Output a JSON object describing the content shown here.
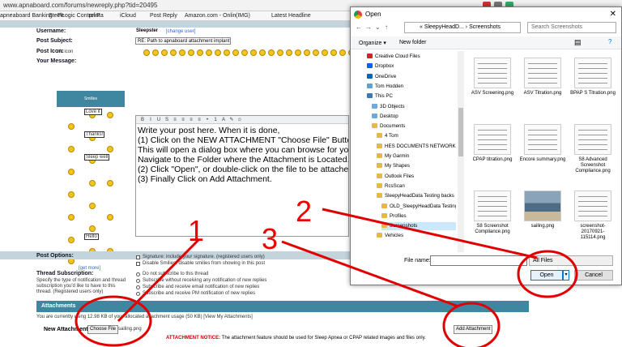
{
  "browser": {
    "url": "www.apnaboard.com/forums/newreply.php?tid=20495",
    "bookmarks": [
      "apneaboard Banking - Pe",
      "SteelLogic Control Pa",
      "print",
      "iCloud",
      "Post Reply",
      "Amazon.com - Onlin",
      "(IMG)",
      "Latest Headline"
    ]
  },
  "form": {
    "username_label": "Username:",
    "username_value": "Sleepster",
    "username_change": "[change user]",
    "subject_label": "Post Subject:",
    "subject_value": "RE: Path to apnaboard attachment implant begins",
    "icon_label": "Post Icon:",
    "icon_none": "no icon",
    "message_label": "Your Message:",
    "smiley_header": "Smilies",
    "smiley_captions": [
      "Love it",
      "Thanks!",
      "Sleep well",
      "Hello"
    ],
    "get_more": "[get more]",
    "editor_lines": [
      "Write your post here. When it is done,",
      "(1) Click on the NEW ATTACHMENT \"Choose File\" Button.",
      "This will open a dialog box where you can browse for your attachment.",
      "Navigate to the Folder where the Attachment is Located.",
      "(2) Click \"Open\", or double-click on the file to be attached.",
      "(3) Finally Click on Add Attachment."
    ],
    "options_label": "Post Options:",
    "option_signature": "Signature: include your signature. (registered users only)",
    "option_disable_smilies": "Disable Smilies: disable smilies from showing in this post",
    "thread_sub_label": "Thread Subscription:",
    "thread_sub_desc": "Specify the type of notification and thread subscription you'd like to have to this thread. (Registered users only)",
    "thread_options": [
      "Do not subscribe to this thread",
      "Subscribe without receiving any notification of new replies",
      "Subscribe and receive email notification of new replies",
      "Subscribe and receive PM notification of new replies"
    ]
  },
  "attachments": {
    "header": "Attachments",
    "usage": "You are currently using 12.98 KB of your allocated attachment usage (50 KB) [View My Attachments]",
    "new_label": "New Attachment:",
    "choose_file": "Choose File",
    "chosen_file": "sailing.png",
    "add_button": "Add Attachment",
    "notice_title": "ATTACHMENT NOTICE:",
    "notice_text": "The attachment feature should be used for Sleep Apnea or CPAP related images and files only."
  },
  "dialog": {
    "title": "Open",
    "close": "✕",
    "path": "« SleepyHeadD... › Screenshots",
    "search_placeholder": "Search Screenshots",
    "organize": "Organize ▾",
    "new_folder": "New folder",
    "tree": [
      {
        "label": "Creative Cloud Files",
        "color": "#da1f26"
      },
      {
        "label": "Dropbox",
        "color": "#0061fe"
      },
      {
        "label": "OneDrive",
        "color": "#0364b8"
      },
      {
        "label": "Tom Hodden",
        "color": "#5ea1d6"
      },
      {
        "label": "This PC",
        "color": "#3b78b6"
      },
      {
        "label": "3D Objects",
        "color": "#6fa9dd"
      },
      {
        "label": "Desktop",
        "color": "#6fa9dd"
      },
      {
        "label": "Documents",
        "color": "#e6b84c"
      },
      {
        "label": "4 Tom",
        "color": "#e6b84c"
      },
      {
        "label": "HES DOCUMENTS NETWORK",
        "color": "#e6b84c"
      },
      {
        "label": "My Garmin",
        "color": "#e6b84c"
      },
      {
        "label": "My Shapes",
        "color": "#e6b84c"
      },
      {
        "label": "Outlook Files",
        "color": "#e6b84c"
      },
      {
        "label": "RcsScan",
        "color": "#e6b84c"
      },
      {
        "label": "SleepyHeadData Testing backs",
        "color": "#e6b84c"
      },
      {
        "label": "OLD_SleepyHeadData Testing",
        "color": "#e6b84c"
      },
      {
        "label": "Profiles",
        "color": "#e6b84c"
      },
      {
        "label": "Screenshots",
        "color": "#e6b84c"
      },
      {
        "label": "Vehicles",
        "color": "#e6b84c"
      }
    ],
    "files": [
      {
        "name": "ASV Screening.png",
        "photo": false
      },
      {
        "name": "ASV Titration.png",
        "photo": false
      },
      {
        "name": "BPAP S Titration.png",
        "photo": false
      },
      {
        "name": "CPAP titration.png",
        "photo": false
      },
      {
        "name": "Encore summary.png",
        "photo": false
      },
      {
        "name": "S8 Advanced Screenshot Compliance.png",
        "photo": false
      },
      {
        "name": "S8 Screenshot Compliance.png",
        "photo": false
      },
      {
        "name": "sailing.png",
        "photo": true
      },
      {
        "name": "screenshot-20170921-115114.png",
        "photo": false
      }
    ],
    "filename_label": "File name:",
    "filename_value": "",
    "filetype": "All Files",
    "open_button": "Open",
    "cancel_button": "Cancel"
  },
  "annotations": [
    "1",
    "2",
    "3"
  ],
  "colors": {
    "annotation": "#e00000",
    "accent": "#3f87a0",
    "dialog_accent": "#0078d7"
  }
}
